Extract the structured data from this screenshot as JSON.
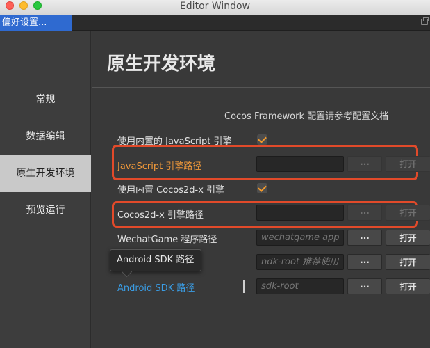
{
  "window": {
    "title": "Editor Window"
  },
  "tab": {
    "label": "偏好设置..."
  },
  "sidebar": {
    "items": [
      {
        "label": "常规"
      },
      {
        "label": "数据编辑"
      },
      {
        "label": "原生开发环境",
        "active": true
      },
      {
        "label": "预览运行"
      }
    ]
  },
  "main": {
    "title": "原生开发环境",
    "hint": "Cocos Framework 配置请参考配置文档",
    "rows": [
      {
        "label": "使用内置的 JavaScript 引擎",
        "type": "checkbox",
        "checked": true
      },
      {
        "label": "JavaScript 引擎路径",
        "type": "path",
        "value": "",
        "placeholder": "",
        "dots": "···",
        "open": "打开",
        "disabled": true,
        "highlight_color": "#f0993a"
      },
      {
        "label": "使用内置 Cocos2d-x 引擎",
        "type": "checkbox",
        "checked": true
      },
      {
        "label": "Cocos2d-x 引擎路径",
        "type": "path",
        "value": "",
        "placeholder": "",
        "dots": "···",
        "open": "打开",
        "disabled": true
      },
      {
        "label": "WechatGame 程序路径",
        "type": "path",
        "placeholder": "wechatgame app",
        "dots": "···",
        "open": "打开"
      },
      {
        "label": "",
        "type": "path",
        "placeholder": "ndk-root 推荐使用",
        "dots": "···",
        "open": "打开"
      },
      {
        "label": "Android SDK 路径",
        "type": "path",
        "placeholder": "sdk-root",
        "dots": "···",
        "open": "打开",
        "label_color": "#3a9de5"
      }
    ]
  },
  "tooltip": {
    "text": "Android SDK 路径"
  },
  "colors": {
    "accent_blue": "#2f6ad0",
    "highlight_red": "#e24a2a",
    "check_orange": "#f49a2a"
  }
}
